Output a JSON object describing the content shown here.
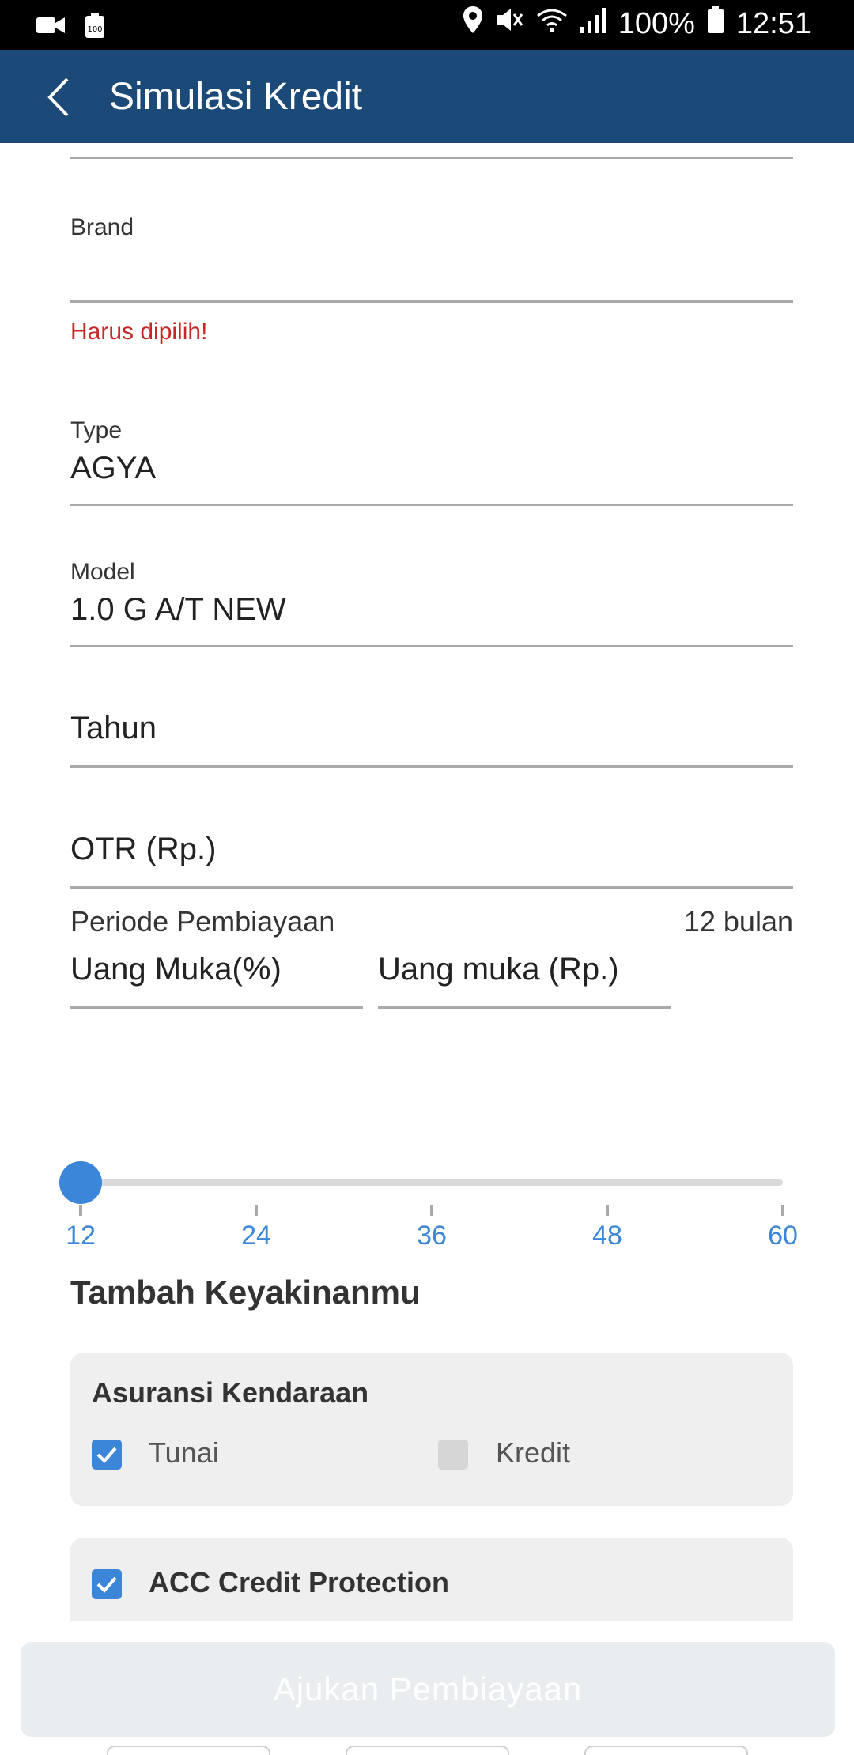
{
  "status_bar": {
    "battery_percent": "100%",
    "time": "12:51",
    "left_icons": [
      "video-camera-icon",
      "battery-100-icon"
    ],
    "right_icons": [
      "location-icon",
      "mute-icon",
      "wifi-icon",
      "signal-icon",
      "battery-icon"
    ]
  },
  "app_bar": {
    "title": "Simulasi Kredit",
    "back_icon": "chevron-left-icon"
  },
  "form": {
    "brand": {
      "label": "Brand",
      "value": "",
      "error": "Harus dipilih!"
    },
    "type": {
      "label": "Type",
      "value": "AGYA"
    },
    "model": {
      "label": "Model",
      "value": "1.0 G A/T NEW"
    },
    "tahun": {
      "placeholder": "Tahun"
    },
    "otr": {
      "placeholder": "OTR (Rp.)"
    },
    "dp_percent": {
      "placeholder": "Uang Muka(%)"
    },
    "dp_rupiah": {
      "placeholder": "Uang muka (Rp.)"
    }
  },
  "period": {
    "label": "Periode Pembiayaan",
    "value_text": "12 bulan",
    "selected": 12,
    "ticks": [
      "12",
      "24",
      "36",
      "48",
      "60"
    ]
  },
  "extras": {
    "section_title": "Tambah Keyakinanmu",
    "insurance": {
      "title": "Asuransi Kendaraan",
      "options": [
        {
          "label": "Tunai",
          "checked": true
        },
        {
          "label": "Kredit",
          "checked": false
        }
      ]
    },
    "credit_protection": {
      "label": "ACC Credit Protection",
      "checked": true
    }
  },
  "submit": {
    "label": "Ajukan Pembiayaan"
  },
  "colors": {
    "app_bar": "#1c4a78",
    "accent": "#3c86d9",
    "error": "#c62828"
  }
}
